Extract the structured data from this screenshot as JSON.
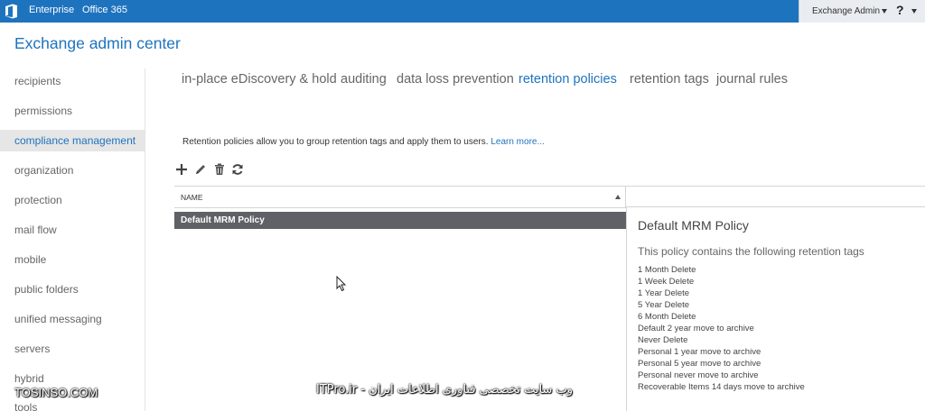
{
  "topbar": {
    "logo_icon": "office-logo-icon",
    "links": [
      "Enterprise",
      "Office 365"
    ],
    "user": "Exchange Admin",
    "help": "?"
  },
  "app_title": "Exchange admin center",
  "nav": {
    "items": [
      "recipients",
      "permissions",
      "compliance management",
      "organization",
      "protection",
      "mail flow",
      "mobile",
      "public folders",
      "unified messaging",
      "servers",
      "hybrid",
      "tools"
    ],
    "selected": "compliance management"
  },
  "tabs": {
    "items": [
      "in-place eDiscovery & hold",
      "auditing",
      "data loss prevention",
      "retention policies",
      "retention tags",
      "journal rules"
    ],
    "active": "retention policies"
  },
  "description": {
    "text": "Retention policies allow you to group retention tags and apply them to users.",
    "link": "Learn more..."
  },
  "toolbar": {
    "icons": [
      "add-icon",
      "edit-icon",
      "delete-icon",
      "refresh-icon"
    ]
  },
  "list": {
    "column": "NAME",
    "rows": [
      "Default MRM Policy"
    ]
  },
  "details": {
    "title": "Default MRM Policy",
    "subtitle": "This policy contains the following retention tags",
    "tags": [
      "1 Month Delete",
      "1 Week Delete",
      "1 Year Delete",
      "5 Year Delete",
      "6 Month Delete",
      "Default 2 year move to archive",
      "Never Delete",
      "Personal 1 year move to archive",
      "Personal 5 year move to archive",
      "Personal never move to archive",
      "Recoverable Items 14 days move to archive"
    ]
  },
  "watermarks": {
    "left": "TOSINSO.COM",
    "right": "ITPro.ir - وب سایت تخصصی فناوری اطلاعات ایران"
  },
  "colors": {
    "accent": "#1e73be",
    "selected_row": "#5f6166"
  }
}
